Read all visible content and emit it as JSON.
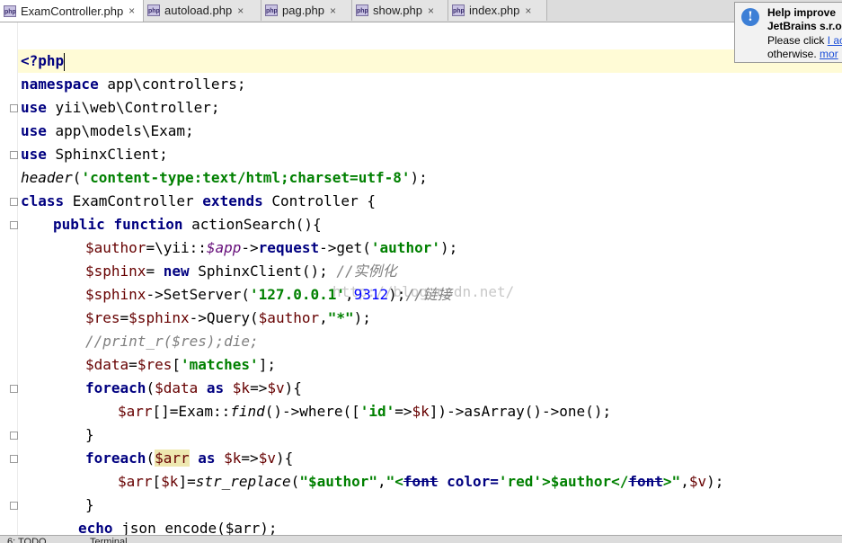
{
  "tabs": [
    {
      "label": "ExamController.php",
      "active": true
    },
    {
      "label": "autoload.php",
      "active": false
    },
    {
      "label": "pag.php",
      "active": false
    },
    {
      "label": "show.php",
      "active": false
    },
    {
      "label": "index.php",
      "active": false
    }
  ],
  "tab_icon_text": "php",
  "tab_close": "×",
  "notification": {
    "line1": "Help improve",
    "line2": "JetBrains s.r.o",
    "line3_prefix": "Please click ",
    "line3_link": "I ac",
    "line4_prefix": "otherwise. ",
    "line4_link": "mor",
    "icon": "info-icon"
  },
  "code": {
    "l1": "<?php",
    "l2_kw": "namespace",
    "l2_rest": " app\\controllers;",
    "l3_kw": "use",
    "l3_rest": " yii\\web\\Controller;",
    "l4_kw": "use",
    "l4_rest": " app\\models\\Exam;",
    "l5_kw": "use",
    "l5_rest": " SphinxClient;",
    "l6_fn": "header",
    "l6_a": "(",
    "l6_str": "'content-type:text/html;charset=utf-8'",
    "l6_b": ");",
    "l7_kw1": "class",
    "l7_mid": " ExamController ",
    "l7_kw2": "extends",
    "l7_rest": " Controller {",
    "l8_kw1": "public",
    "l8_sp": " ",
    "l8_kw2": "function",
    "l8_rest": " actionSearch(){",
    "l9_var": "$author",
    "l9_a": "=\\yii::",
    "l9_fld": "$app",
    "l9_b": "->",
    "l9_req": "request",
    "l9_c": "->get(",
    "l9_str": "'author'",
    "l9_d": ");",
    "l10_var": "$sphinx",
    "l10_a": "= ",
    "l10_kw": "new",
    "l10_b": " SphinxClient(); ",
    "l10_cmt": "//实例化",
    "l11_var": "$sphinx",
    "l11_a": "->SetServer(",
    "l11_str": "'127.0.0.1'",
    "l11_b": ",",
    "l11_num": "9312",
    "l11_c": ");",
    "l11_cmt": "//链接",
    "l12_var1": "$res",
    "l12_a": "=",
    "l12_var2": "$sphinx",
    "l12_b": "->Query(",
    "l12_var3": "$author",
    "l12_c": ",",
    "l12_str": "\"*\"",
    "l12_d": ");",
    "l13_cmt": "//print_r($res);die;",
    "l14_var1": "$data",
    "l14_a": "=",
    "l14_var2": "$res",
    "l14_b": "[",
    "l14_str": "'matches'",
    "l14_c": "];",
    "l15_kw1": "foreach",
    "l15_a": "(",
    "l15_var1": "$data",
    "l15_sp": " ",
    "l15_kw2": "as",
    "l15_sp2": " ",
    "l15_var2": "$k",
    "l15_b": "=>",
    "l15_var3": "$v",
    "l15_c": "){",
    "l16_var1": "$arr",
    "l16_a": "[]=Exam::",
    "l16_fn": "find",
    "l16_b": "()->where([",
    "l16_str": "'id'",
    "l16_c": "=>",
    "l16_var2": "$k",
    "l16_d": "])->asArray()->one();",
    "l17": "}",
    "l18_kw1": "foreach",
    "l18_a": "(",
    "l18_var1": "$arr",
    "l18_sp": " ",
    "l18_kw2": "as",
    "l18_sp2": " ",
    "l18_var2": "$k",
    "l18_b": "=>",
    "l18_var3": "$v",
    "l18_c": "){",
    "l19_var1": "$arr",
    "l19_a": "[",
    "l19_var2": "$k",
    "l19_b": "]=",
    "l19_fn": "str_replace",
    "l19_c": "(",
    "l19_s1": "\"$author\"",
    "l19_d": ",",
    "l19_s2a": "\"<",
    "l19_tag1": "font",
    "l19_s2b": " ",
    "l19_attr": "color=",
    "l19_s2c": "'red'",
    "l19_s2d": ">$author</",
    "l19_tag2": "font",
    "l19_s2e": ">\"",
    "l19_e": ",",
    "l19_var3": "$v",
    "l19_f": ");",
    "l20": "}",
    "l21_kw": "echo",
    "l21_rest": " json_encode($arr);"
  },
  "watermark": "http://blog.csdn.net/",
  "bottom": {
    "todo": "6: TODO",
    "terminal": "Terminal"
  },
  "colors": {
    "keyword": "#000080",
    "string": "#008000",
    "number": "#0000ff",
    "comment": "#808080",
    "current_line": "#fffbd6"
  }
}
